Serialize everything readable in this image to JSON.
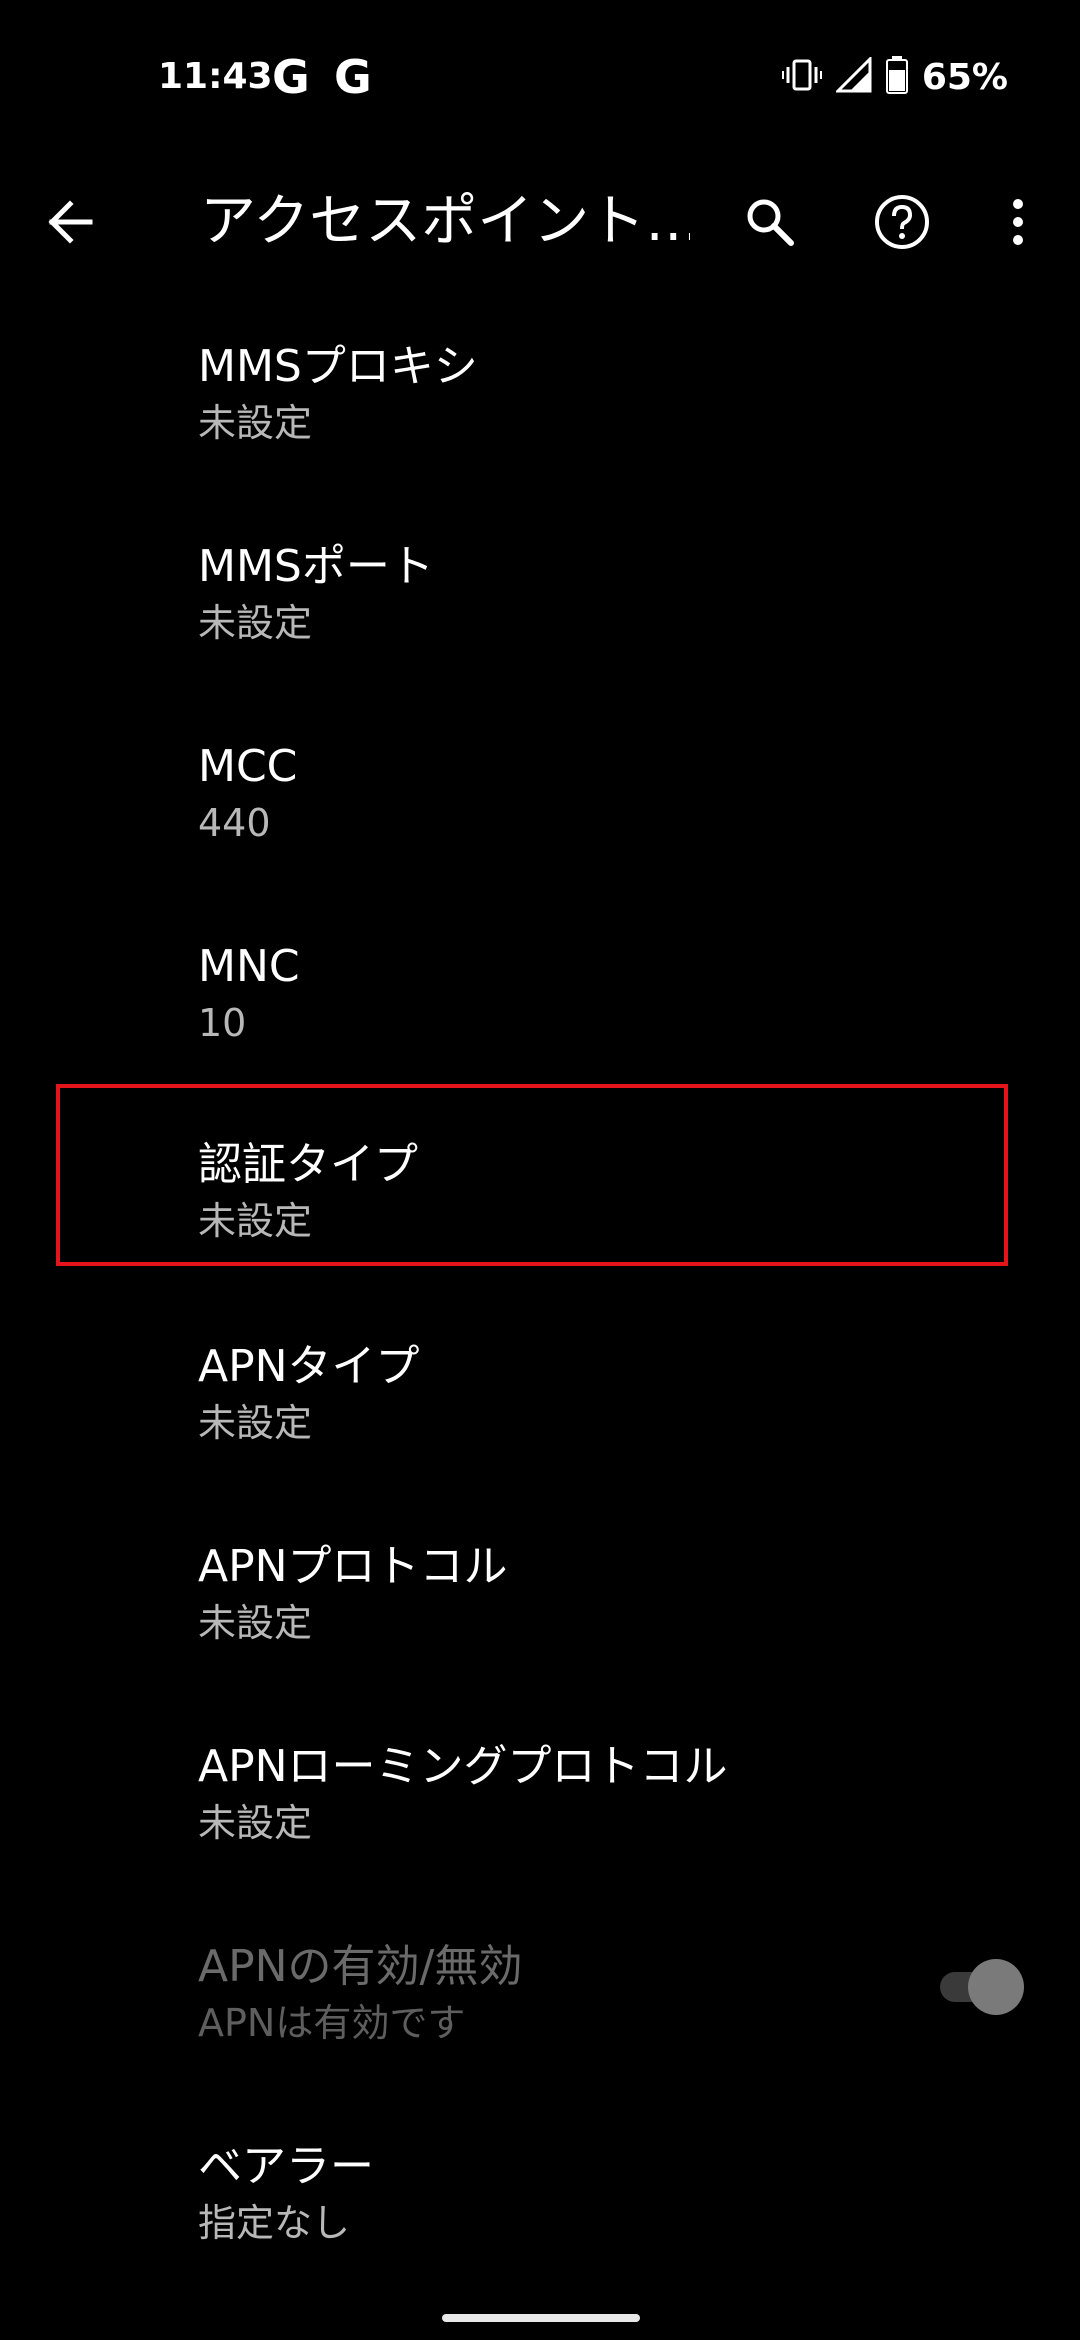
{
  "status_bar": {
    "time": "11:43",
    "notification_icons": [
      "G",
      "G"
    ],
    "battery_percent": "65%"
  },
  "app_bar": {
    "title": "アクセスポイント…"
  },
  "items": [
    {
      "title": "MMSプロキシ",
      "summary": "未設定"
    },
    {
      "title": "MMSポート",
      "summary": "未設定"
    },
    {
      "title": "MCC",
      "summary": "440"
    },
    {
      "title": "MNC",
      "summary": "10"
    },
    {
      "title": "認証タイプ",
      "summary": "未設定"
    },
    {
      "title": "APNタイプ",
      "summary": "未設定"
    },
    {
      "title": "APNプロトコル",
      "summary": "未設定"
    },
    {
      "title": "APNローミングプロトコル",
      "summary": "未設定"
    },
    {
      "title": "APNの有効/無効",
      "summary": "APNは有効です"
    },
    {
      "title": "ベアラー",
      "summary": "指定なし"
    }
  ],
  "colors": {
    "background": "#000000",
    "highlight": "#e4141b",
    "summary_text": "#b8b8b8",
    "disabled_text": "#6a6a6a"
  }
}
